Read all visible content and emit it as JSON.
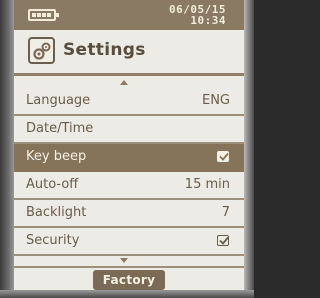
{
  "status_bar": {
    "battery_icon": "battery-full-icon",
    "date": "06/05/15",
    "time": "10:34"
  },
  "header": {
    "icon": "settings-icon",
    "title": "Settings"
  },
  "menu": {
    "items": [
      {
        "label": "Language",
        "value": "ENG"
      },
      {
        "label": "Date/Time",
        "value": ""
      },
      {
        "label": "Key beep",
        "checked": true,
        "selected": true
      },
      {
        "label": "Auto-off",
        "value": "15 min"
      },
      {
        "label": "Backlight",
        "value": "7"
      },
      {
        "label": "Security",
        "checked": true
      }
    ]
  },
  "footer": {
    "factory_label": "Factory"
  },
  "colors": {
    "accent": "#85735a",
    "text": "#6a5c4a",
    "background": "#ecebe6"
  }
}
